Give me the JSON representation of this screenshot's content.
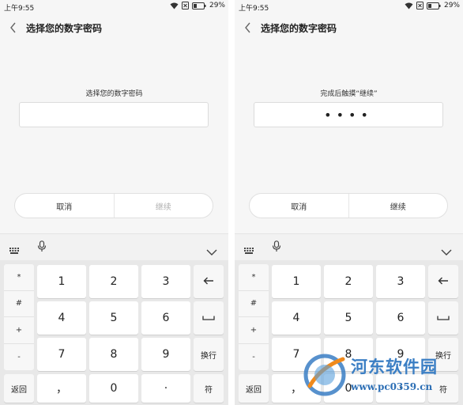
{
  "status": {
    "time": "上午9:55",
    "battery": "29%"
  },
  "screens": [
    {
      "title": "选择您的数字密码",
      "prompt": "选择您的数字密码",
      "pin_value": "",
      "cancel_label": "取消",
      "continue_label": "继续",
      "continue_enabled": false
    },
    {
      "title": "选择您的数字密码",
      "prompt": "完成后触摸“继续”",
      "pin_value": "••••",
      "cancel_label": "取消",
      "continue_label": "继续",
      "continue_enabled": true
    }
  ],
  "keyboard": {
    "symbols": [
      "*",
      "#",
      "+",
      "-"
    ],
    "digits": [
      "1",
      "2",
      "3",
      "4",
      "5",
      "6",
      "7",
      "8",
      "9",
      "0"
    ],
    "backspace": "←",
    "space": "⎵",
    "newline": "换行",
    "back": "返回",
    "comma": "，",
    "dot": "·",
    "symbol_key": "符"
  },
  "watermark": {
    "text": "河东软件园",
    "url": "www.pc0359.cn"
  },
  "colors": {
    "accent": "#3a7ec4",
    "disabled_text": "#b0b0b0",
    "background": "#f6f6f6"
  }
}
